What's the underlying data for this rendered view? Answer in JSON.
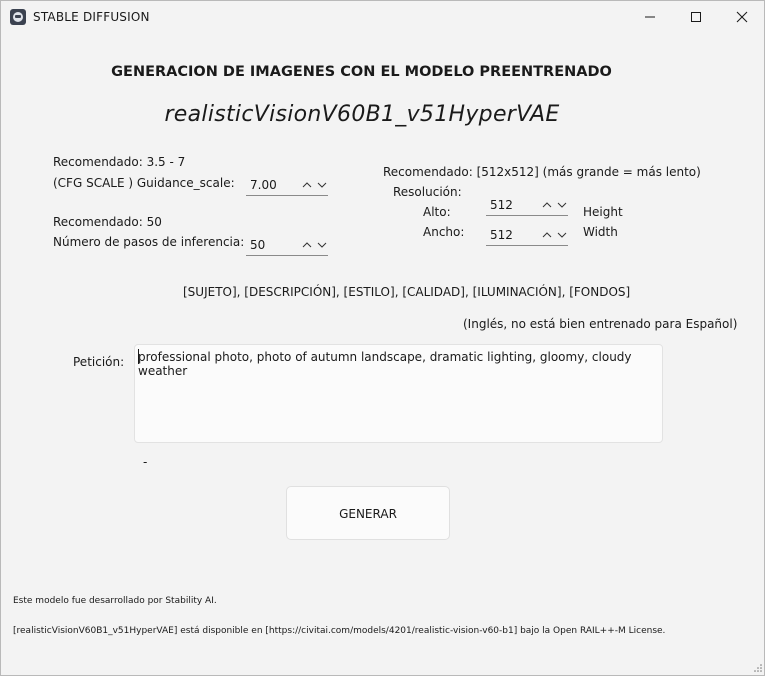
{
  "window": {
    "title": "STABLE DIFFUSION"
  },
  "header": {
    "heading": "GENERACION DE IMAGENES CON EL MODELO PREENTRENADO",
    "model_name": "realisticVisionV60B1_v51HyperVAE"
  },
  "guidance": {
    "recommendation": "Recomendado: 3.5 - 7",
    "label": "(CFG SCALE ) Guidance_scale:",
    "value": "7.00"
  },
  "steps": {
    "recommendation": "Recomendado: 50",
    "label": "Número de pasos de inferencia:",
    "value": "50"
  },
  "resolution": {
    "recommendation": "Recomendado:  [512x512] (más grande =  más lento)",
    "label": "Resolución:",
    "alto_label": "Alto:",
    "alto_value": "512",
    "alto_unit": "Height",
    "ancho_label": "Ancho:",
    "ancho_value": "512",
    "ancho_unit": "Width"
  },
  "template_hint": "[SUJETO], [DESCRIPCIÓN], [ESTILO], [CALIDAD], [ILUMINACIÓN], [FONDOS]",
  "language_note": "(Inglés, no está bien entrenado para Español)",
  "prompt": {
    "label": "Petición:",
    "value": "professional photo, photo of autumn landscape, dramatic lighting, gloomy, cloudy weather"
  },
  "status": "-",
  "generate_button": "GENERAR",
  "footer": {
    "credit": "Este modelo fue desarrollado por Stability AI.",
    "license": "[realisticVisionV60B1_v51HyperVAE] está disponible en [https://civitai.com/models/4201/realistic-vision-v60-b1] bajo la Open RAIL++-M License."
  }
}
